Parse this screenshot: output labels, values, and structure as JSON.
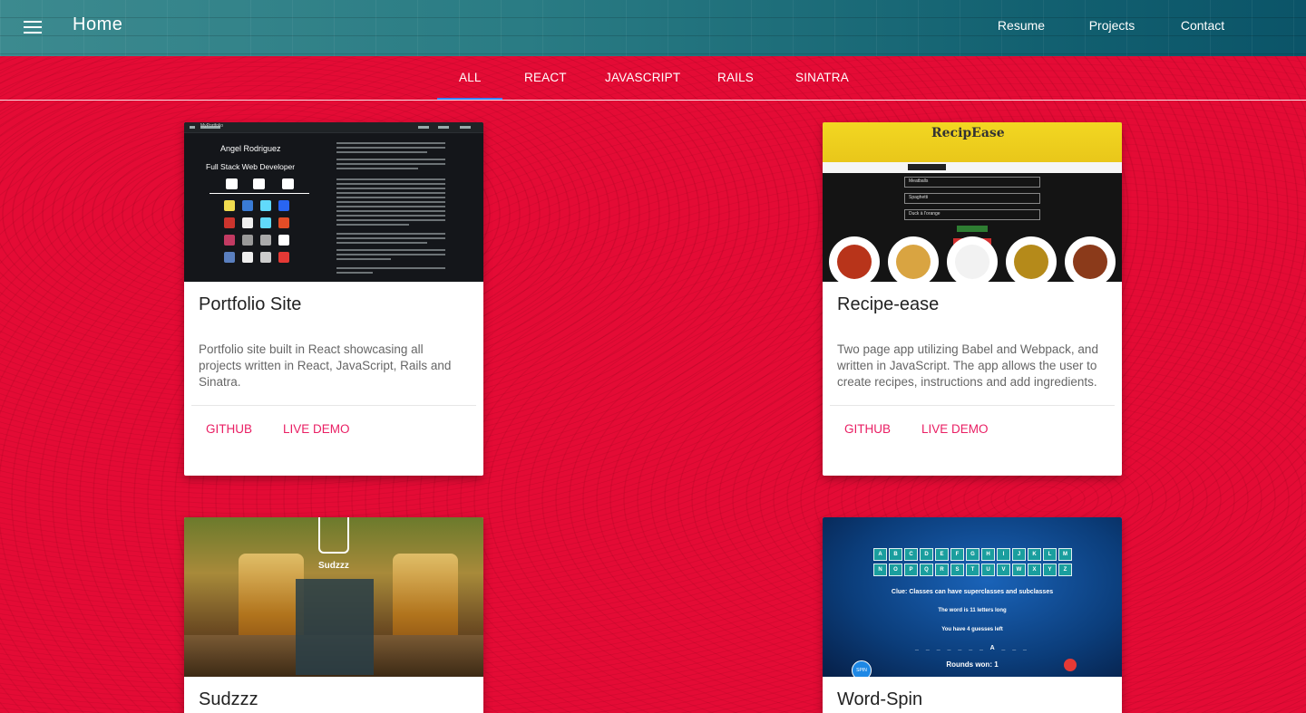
{
  "appbar": {
    "title": "Home",
    "nav": [
      "Resume",
      "Projects",
      "Contact"
    ]
  },
  "tabs": [
    "ALL",
    "REACT",
    "JAVASCRIPT",
    "RAILS",
    "SINATRA"
  ],
  "active_tab": "ALL",
  "colors": {
    "background": "#e40b35",
    "appbar": "#1d6f78",
    "tab_indicator": "#3b82f6",
    "action_link": "#e91e63"
  },
  "cards": [
    {
      "title": "Portfolio Site",
      "description": "Portfolio site built in React showcasing all projects written in React, JavaScript, Rails and Sinatra.",
      "actions": [
        "GITHUB",
        "LIVE DEMO"
      ],
      "screenshot": {
        "brand": "MyPortfolio",
        "name": "Angel Rodriguez",
        "role": "Full Stack Web Developer"
      }
    },
    {
      "title": "Recipe-ease",
      "description": "Two page app utilizing Babel and Webpack, and written in JavaScript. The app allows the user to create recipes, instructions and add ingredients.",
      "actions": [
        "GITHUB",
        "LIVE DEMO"
      ],
      "screenshot": {
        "logo": "RecipEase",
        "rows": [
          "Meatballs",
          "Spaghetti",
          "Duck à l'orange"
        ]
      }
    },
    {
      "title": "Sudzzz",
      "screenshot": {
        "logo": "Sudzzz"
      }
    },
    {
      "title": "Word-Spin",
      "screenshot": {
        "letters": [
          "A",
          "B",
          "C",
          "D",
          "E",
          "F",
          "G",
          "H",
          "I",
          "J",
          "K",
          "L",
          "M",
          "N",
          "O",
          "P",
          "Q",
          "R",
          "S",
          "T",
          "U",
          "V",
          "W",
          "X",
          "Y",
          "Z"
        ],
        "clue": "Clue: Classes can have superclasses and subclasses",
        "length": "The word is 11 letters long",
        "guesses": "You have 4 guesses left",
        "blanks": "_ _ _ _ _ _ _ A _ _ _",
        "rounds": "Rounds won: 1",
        "spin": "SPIN"
      }
    }
  ]
}
